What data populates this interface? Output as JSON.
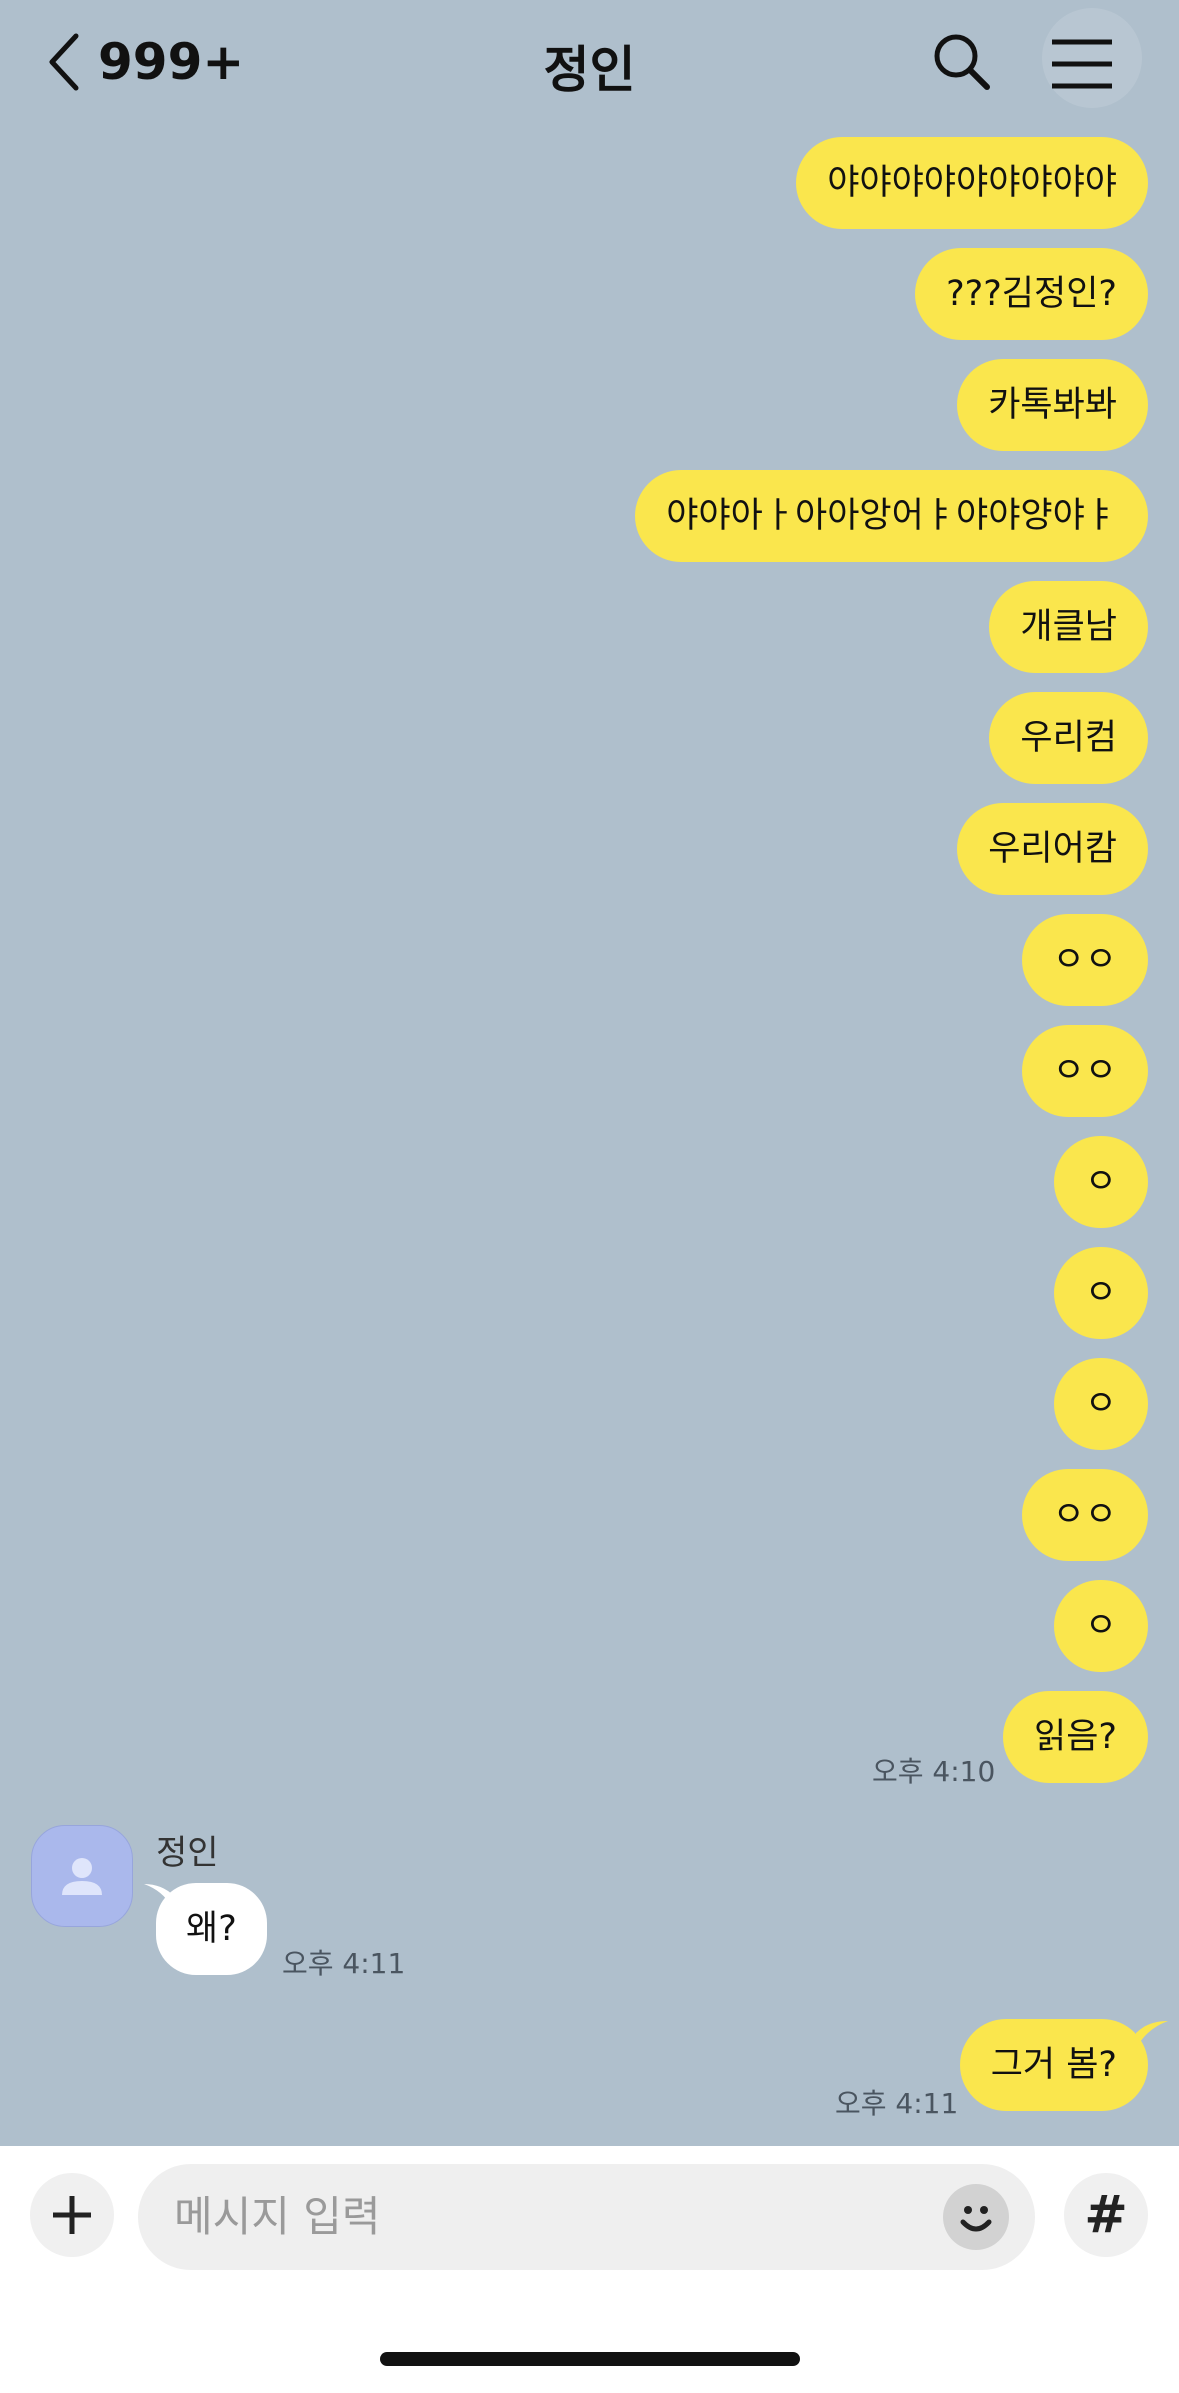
{
  "header": {
    "back_count": "999+",
    "title": "정인"
  },
  "messages_sent_1": [
    {
      "text": "야야야야야야야야야"
    },
    {
      "text": "???김정인?"
    },
    {
      "text": "카톡봐봐"
    },
    {
      "text": "야야아ㅏ아아앙어ㅑ야야양야ㅑ"
    },
    {
      "text": "개클남"
    },
    {
      "text": "우리컴"
    },
    {
      "text": "우리어캄"
    },
    {
      "text": "ㅇㅇ"
    },
    {
      "text": "ㅇㅇ"
    },
    {
      "text": "ㅇ"
    },
    {
      "text": "ㅇ"
    },
    {
      "text": "ㅇ"
    },
    {
      "text": "ㅇㅇ"
    },
    {
      "text": "ㅇ"
    },
    {
      "text": "읽음?"
    }
  ],
  "time_sent_1": "오후 4:10",
  "received": {
    "sender": "정인",
    "text": "왜?",
    "time": "오후 4:11"
  },
  "sent_last": {
    "text": "그거 봄?",
    "time": "오후 4:11"
  },
  "input": {
    "placeholder": "메시지 입력"
  },
  "colors": {
    "background": "#afbfcc",
    "my_bubble": "#fae64d",
    "their_bubble": "#ffffff"
  }
}
